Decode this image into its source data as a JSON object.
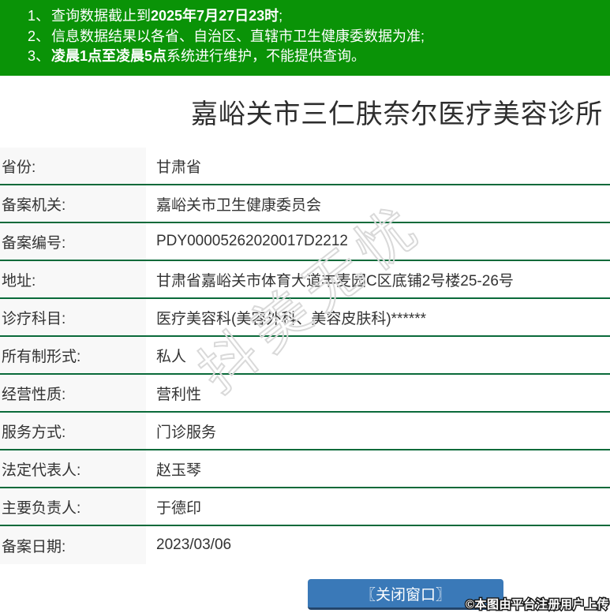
{
  "notices": {
    "items": [
      {
        "num": "1、",
        "pre": "查询数据截止到",
        "bold": "2025年7月27日23时",
        "post": ";"
      },
      {
        "num": "2、",
        "pre": "信息数据结果以各省、自治区、直辖市卫生健康委数据为准;",
        "bold": "",
        "post": ""
      },
      {
        "num": "3、",
        "pre": "",
        "bold": "凌晨1点至凌晨5点",
        "post": "系统进行维护，不能提供查询。"
      }
    ]
  },
  "title": "嘉峪关市三仁肤奈尔医疗美容诊所",
  "table": {
    "rows": [
      {
        "label": "省份:",
        "value": "甘肃省"
      },
      {
        "label": "备案机关:",
        "value": "嘉峪关市卫生健康委员会"
      },
      {
        "label": "备案编号:",
        "value": "PDY00005262020017D2212"
      },
      {
        "label": "地址:",
        "value": "甘肃省嘉峪关市体育大道丰麦园C区底铺2号楼25-26号"
      },
      {
        "label": "诊疗科目:",
        "value": "医疗美容科(美容外科、美容皮肤科)******"
      },
      {
        "label": "所有制形式:",
        "value": "私人"
      },
      {
        "label": "经营性质:",
        "value": "营利性"
      },
      {
        "label": "服务方式:",
        "value": "门诊服务"
      },
      {
        "label": "法定代表人:",
        "value": "赵玉琴"
      },
      {
        "label": "主要负责人:",
        "value": "于德印"
      },
      {
        "label": "备案日期:",
        "value": "2023/03/06"
      }
    ]
  },
  "watermark": "抖美无忧",
  "close_button": "〖关闭窗口〗",
  "caption": "©本图由平台注册用户上传",
  "colors": {
    "banner_green": "#0a9307",
    "separator_green": "#0a6a3a",
    "button_blue": "#3a79b8",
    "button_blue_dark": "#23456b",
    "label_bg": "#f8f8f8",
    "text": "#333333"
  }
}
